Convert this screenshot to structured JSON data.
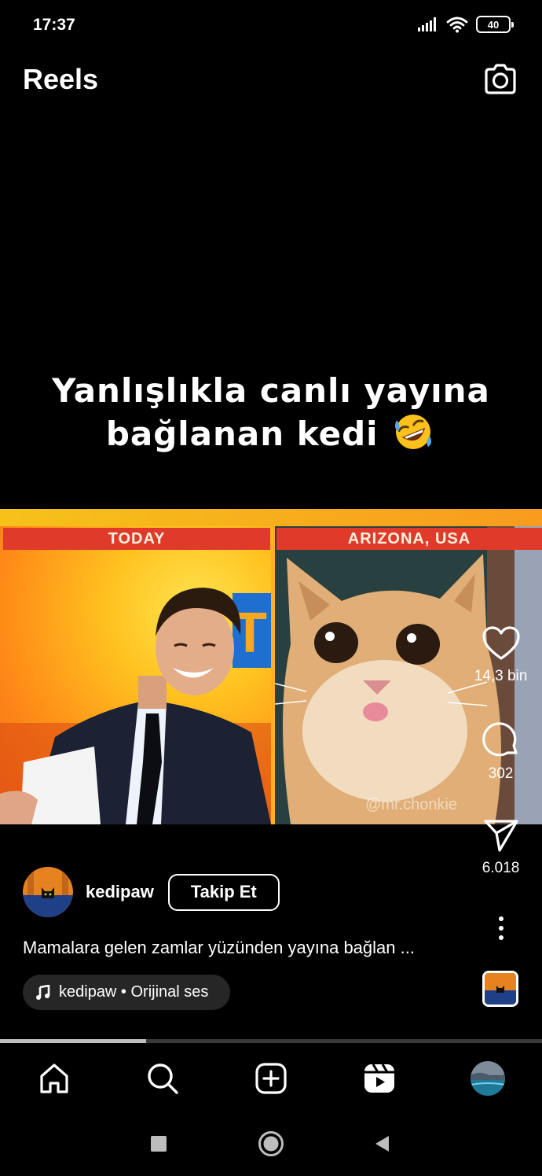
{
  "status_bar": {
    "time": "17:37",
    "battery": "40"
  },
  "header": {
    "title": "Reels"
  },
  "video": {
    "caption_line1": "Yanlışlıkla canlı yayına",
    "caption_line2": "bağlanan kedi",
    "panel_left_label": "TODAY",
    "panel_right_label": "ARIZONA, USA",
    "watermark": "@mr.chonkie"
  },
  "actions": {
    "likes": "14,3 bin",
    "comments": "302",
    "shares": "6.018"
  },
  "post": {
    "username": "kedipaw",
    "follow_label": "Takip Et",
    "description": "Mamalara gelen zamlar yüzünden yayına bağlan ...",
    "audio": "kedipaw • Orijinal ses"
  },
  "playback": {
    "progress": 0.27
  },
  "icons": {
    "camera": "camera-icon",
    "like": "heart-icon",
    "comment": "comment-icon",
    "share": "send-icon",
    "more": "more-vertical-icon",
    "music": "music-note-icon",
    "home": "home-icon",
    "search": "search-icon",
    "create": "add-post-icon",
    "reels": "reels-icon",
    "profile": "profile-avatar"
  }
}
